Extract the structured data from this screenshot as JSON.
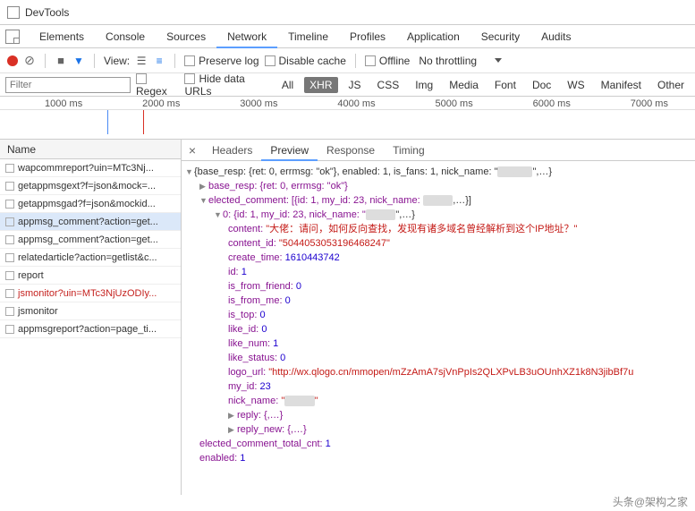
{
  "window": {
    "title": "DevTools"
  },
  "tabs": {
    "items": [
      "Elements",
      "Console",
      "Sources",
      "Network",
      "Timeline",
      "Profiles",
      "Application",
      "Security",
      "Audits"
    ],
    "active": "Network"
  },
  "toolbar": {
    "view_label": "View:",
    "preserve_log": "Preserve log",
    "disable_cache": "Disable cache",
    "offline": "Offline",
    "throttling": "No throttling"
  },
  "filter": {
    "placeholder": "Filter",
    "regex": "Regex",
    "hide_data_urls": "Hide data URLs",
    "types": [
      "All",
      "XHR",
      "JS",
      "CSS",
      "Img",
      "Media",
      "Font",
      "Doc",
      "WS",
      "Manifest",
      "Other"
    ],
    "active_type": "XHR"
  },
  "timeline": {
    "marks": [
      "1000 ms",
      "2000 ms",
      "3000 ms",
      "4000 ms",
      "5000 ms",
      "6000 ms",
      "7000 ms"
    ]
  },
  "requests": {
    "header": "Name",
    "items": [
      {
        "name": "wapcommreport?uin=MTc3Nj...",
        "sel": false,
        "red": false
      },
      {
        "name": "getappmsgext?f=json&mock=...",
        "sel": false,
        "red": false
      },
      {
        "name": "getappmsgad?f=json&mockid...",
        "sel": false,
        "red": false
      },
      {
        "name": "appmsg_comment?action=get...",
        "sel": true,
        "red": false
      },
      {
        "name": "appmsg_comment?action=get...",
        "sel": false,
        "red": false
      },
      {
        "name": "relatedarticle?action=getlist&c...",
        "sel": false,
        "red": false
      },
      {
        "name": "report",
        "sel": false,
        "red": false
      },
      {
        "name": "jsmonitor?uin=MTc3NjUzODIy...",
        "sel": false,
        "red": true
      },
      {
        "name": "jsmonitor",
        "sel": false,
        "red": false
      },
      {
        "name": "appmsgreport?action=page_ti...",
        "sel": false,
        "red": false
      }
    ]
  },
  "detail": {
    "tabs": [
      "Headers",
      "Preview",
      "Response",
      "Timing"
    ],
    "active": "Preview",
    "close": "×"
  },
  "preview": {
    "root_summary": "{base_resp: {ret: 0, errmsg: \"ok\"}, enabled: 1, is_fans: 1, nick_name: \"",
    "root_tail": "\",…}",
    "base_resp": "base_resp: {ret: 0, errmsg: \"ok\"}",
    "elected_comment": "elected_comment: [{id: 1, my_id: 23, nick_name: ",
    "elected_tail": ",…}]",
    "item0": "0: {id: 1, my_id: 23, nick_name: \"",
    "item0_tail": "\",…}",
    "content_key": "content:",
    "content_val": "\"大佬：请问，如何反向查找，发现有诸多域名曾经解析到这个IP地址？\"",
    "content_id_key": "content_id:",
    "content_id_val": "\"5044053053196468247\"",
    "create_time_key": "create_time:",
    "create_time_val": "1610443742",
    "id_key": "id:",
    "id_val": "1",
    "is_from_friend_key": "is_from_friend:",
    "is_from_friend_val": "0",
    "is_from_me_key": "is_from_me:",
    "is_from_me_val": "0",
    "is_top_key": "is_top:",
    "is_top_val": "0",
    "like_id_key": "like_id:",
    "like_id_val": "0",
    "like_num_key": "like_num:",
    "like_num_val": "1",
    "like_status_key": "like_status:",
    "like_status_val": "0",
    "logo_url_key": "logo_url:",
    "logo_url_val": "\"http://wx.qlogo.cn/mmopen/mZzAmA7sjVnPpIs2QLXPvLB3uOUnhXZ1k8N3jibBf7u",
    "my_id_key": "my_id:",
    "my_id_val": "23",
    "nick_name_key": "nick_name:",
    "nick_name_val": "\"",
    "nick_name_tail": "\"",
    "reply": "reply: {,…}",
    "reply_new": "reply_new: {,…}",
    "total_cnt_key": "elected_comment_total_cnt:",
    "total_cnt_val": "1",
    "enabled_key": "enabled:",
    "enabled_val": "1"
  },
  "watermark": "头条@架构之家"
}
